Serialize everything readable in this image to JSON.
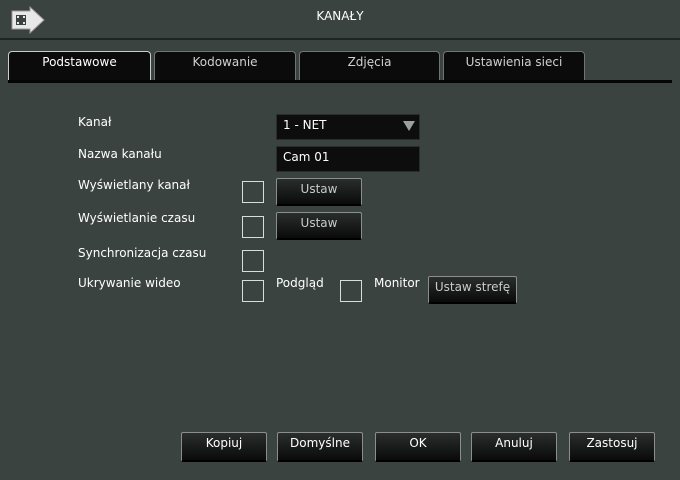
{
  "window": {
    "title": "KANAŁY",
    "logo_icon": "film-arrow-icon"
  },
  "tabs": [
    {
      "label": "Podstawowe",
      "active": true
    },
    {
      "label": "Kodowanie",
      "active": false
    },
    {
      "label": "Zdjęcia",
      "active": false
    },
    {
      "label": "Ustawienia sieci",
      "active": false
    }
  ],
  "form": {
    "channel": {
      "label": "Kanał",
      "value": "1 - NET"
    },
    "channel_name": {
      "label": "Nazwa kanału",
      "value": "Cam 01"
    },
    "display_channel": {
      "label": "Wyświetlany kanał",
      "checked": false,
      "button": "Ustaw"
    },
    "display_time": {
      "label": "Wyświetlanie czasu",
      "checked": false,
      "button": "Ustaw"
    },
    "time_sync": {
      "label": "Synchronizacja czasu",
      "checked": false
    },
    "video_hide": {
      "label": "Ukrywanie wideo",
      "preview_label": "Podgląd",
      "preview_checked": false,
      "monitor_label": "Monitor",
      "monitor_checked": false,
      "zone_button": "Ustaw strefę"
    }
  },
  "buttons": {
    "copy": "Kopiuj",
    "defaults": "Domyślne",
    "ok": "OK",
    "cancel": "Anuluj",
    "apply": "Zastosuj"
  },
  "colors": {
    "background": "#3b4340",
    "field_bg": "#0d0d0d",
    "tab_bg": "#0b0b0b"
  }
}
